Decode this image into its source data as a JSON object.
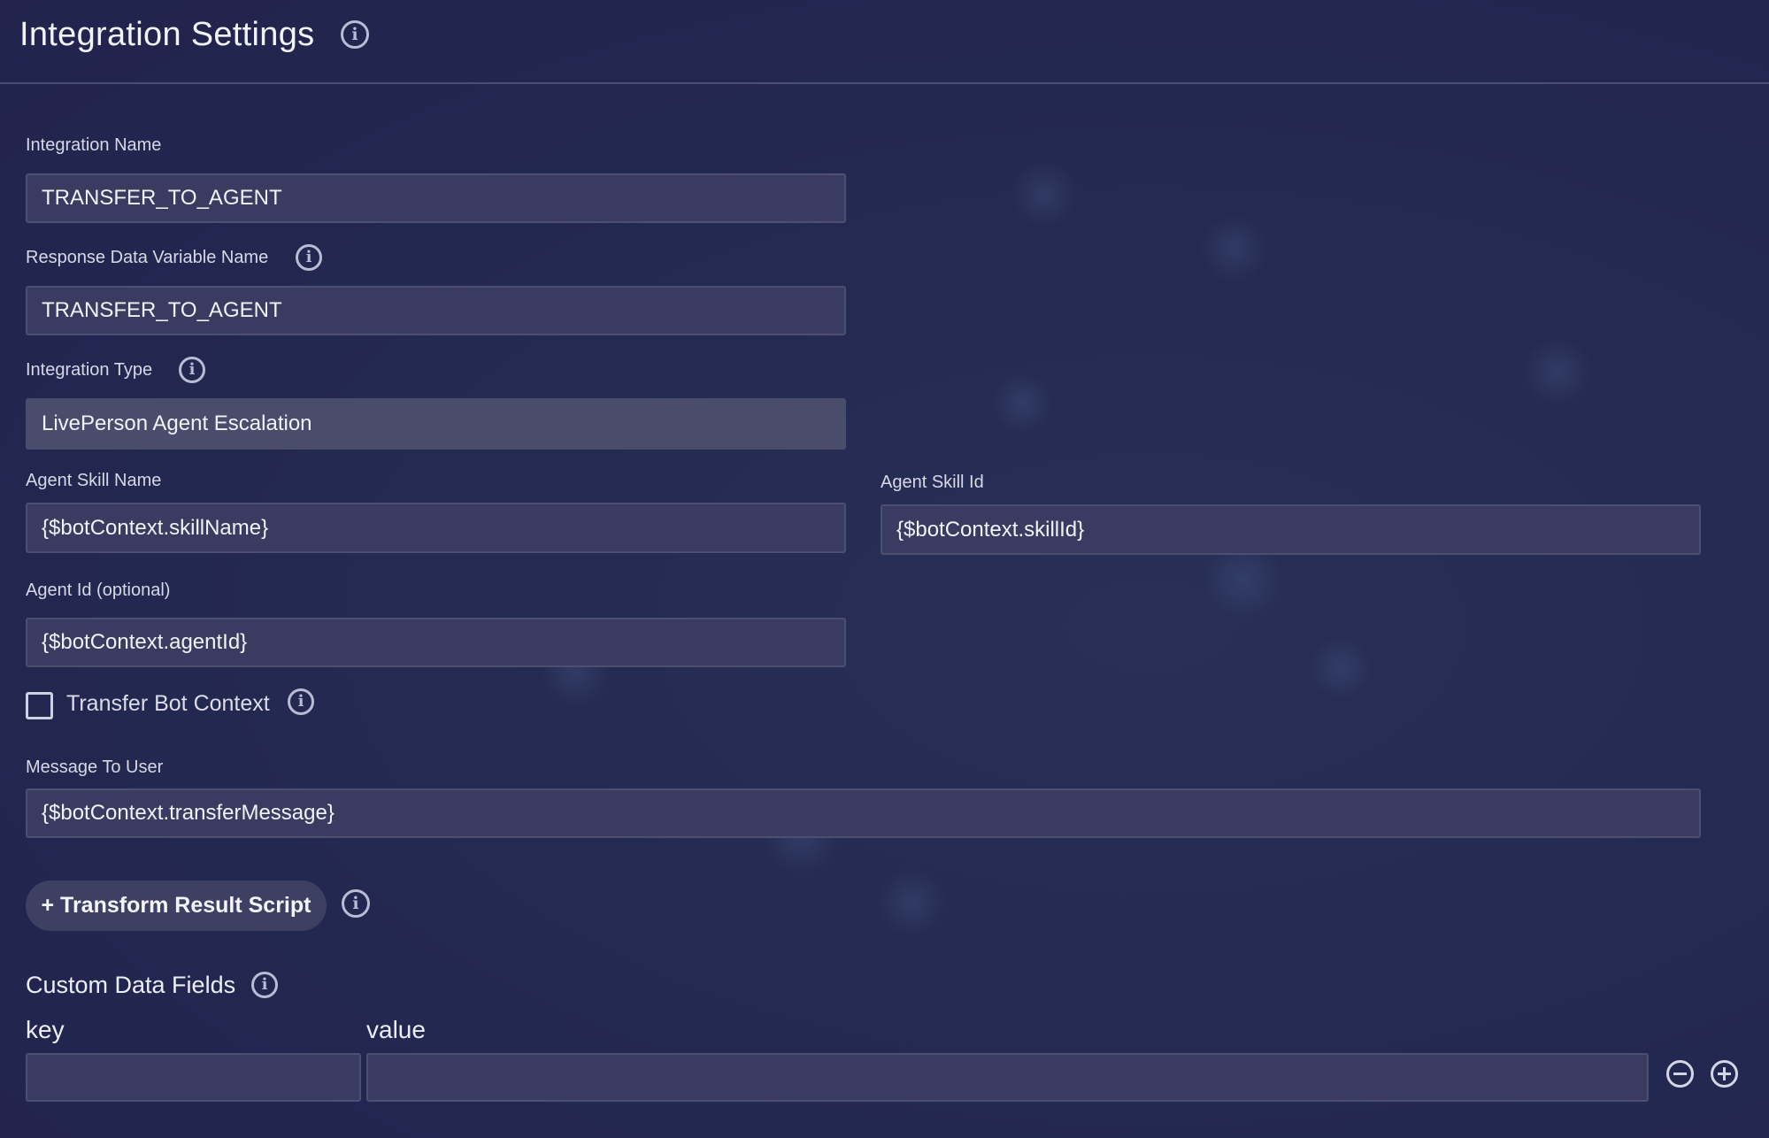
{
  "header": {
    "title": "Integration Settings",
    "info_icon": "info-icon"
  },
  "form": {
    "integration_name": {
      "label": "Integration Name",
      "value": "TRANSFER_TO_AGENT"
    },
    "response_var": {
      "label": "Response Data Variable Name",
      "value": "TRANSFER_TO_AGENT"
    },
    "integration_type": {
      "label": "Integration Type",
      "value": "LivePerson Agent Escalation"
    },
    "agent_skill_name": {
      "label": "Agent Skill Name",
      "value": "{$botContext.skillName}"
    },
    "agent_skill_id": {
      "label": "Agent Skill Id",
      "value": "{$botContext.skillId}"
    },
    "agent_id": {
      "label": "Agent Id (optional)",
      "value": "{$botContext.agentId}"
    },
    "transfer_bot_context": {
      "label": "Transfer Bot Context",
      "checked": false
    },
    "message_to_user": {
      "label": "Message To User",
      "value": "{$botContext.transferMessage}"
    },
    "transform_button": {
      "label": "+ Transform Result Script"
    }
  },
  "custom_data": {
    "title": "Custom Data Fields",
    "key_label": "key",
    "value_label": "value",
    "rows": [
      {
        "key": "",
        "value": ""
      }
    ],
    "remove_icon": "minus-circle-icon",
    "add_icon": "plus-circle-icon"
  },
  "colors": {
    "background": "#242a52",
    "field_bg": "#393c60",
    "readonly_bg": "#4a4c6c",
    "icon": "#b9bcd4"
  }
}
